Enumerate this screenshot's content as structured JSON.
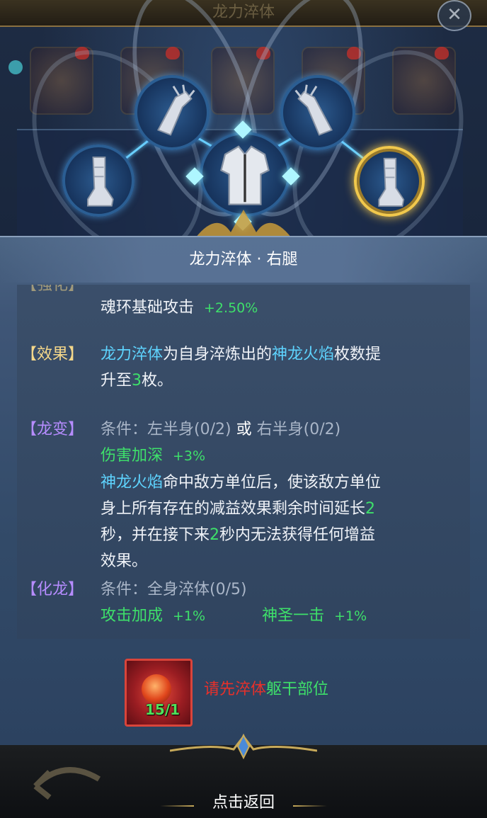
{
  "header": {
    "title": "龙力淬体"
  },
  "panel": {
    "title": "龙力淬体 · 右腿"
  },
  "attributes": {
    "partial_label": "【强化】",
    "stat_name": "魂环基础攻击",
    "stat_value": "+2.50%"
  },
  "effect": {
    "tag": "【效果】",
    "parts": [
      {
        "text": "龙力淬体",
        "color": "cyan"
      },
      {
        "text": "为自身淬炼出的",
        "color": "white"
      },
      {
        "text": "神龙火焰",
        "color": "cyan"
      },
      {
        "text": "枚数提升至",
        "color": "white"
      },
      {
        "text": "3",
        "color": "green"
      },
      {
        "text": "枚。",
        "color": "white"
      }
    ]
  },
  "dragon_change": {
    "tag": "【龙变】",
    "condition_prefix": "条件：",
    "condition_a": "左半身(0/2)",
    "or": "或",
    "condition_b": "右半身(0/2)",
    "bonus_name": "伤害加深",
    "bonus_value": "+3%",
    "desc_parts": [
      {
        "text": "神龙火焰",
        "color": "cyan"
      },
      {
        "text": "命中敌方单位后，使该敌方单位身上所有存在的减益效果剩余时间延长",
        "color": "white"
      },
      {
        "text": "2",
        "color": "green"
      },
      {
        "text": "秒，并在接下来",
        "color": "white"
      },
      {
        "text": "2",
        "color": "green"
      },
      {
        "text": "秒内无法获得任何增益效果。",
        "color": "white"
      }
    ]
  },
  "dragon_form": {
    "tag": "【化龙】",
    "condition": "条件：全身淬体(0/5)",
    "bonus1_name": "攻击加成",
    "bonus1_value": "+1%",
    "bonus2_name": "神圣一击",
    "bonus2_value": "+1%"
  },
  "item": {
    "count": "15/1",
    "icon": "dragon-flame-gem-icon"
  },
  "hint": {
    "prefix": "请先淬体",
    "part": "躯干部位"
  },
  "footer": {
    "back_label": "点击返回"
  },
  "nodes": [
    {
      "name": "left-leg",
      "icon": "boot-icon"
    },
    {
      "name": "left-arm",
      "icon": "gauntlet-icon"
    },
    {
      "name": "torso",
      "icon": "armor-icon"
    },
    {
      "name": "right-arm",
      "icon": "gauntlet-icon"
    },
    {
      "name": "right-leg",
      "icon": "boot-icon",
      "selected": true
    }
  ],
  "colors": {
    "cyan": "#5ed4ff",
    "green": "#3ee06a",
    "gold": "#f4d78a",
    "purple": "#b68cff",
    "red": "#e8302a",
    "selected_border": "#f1c84c"
  }
}
